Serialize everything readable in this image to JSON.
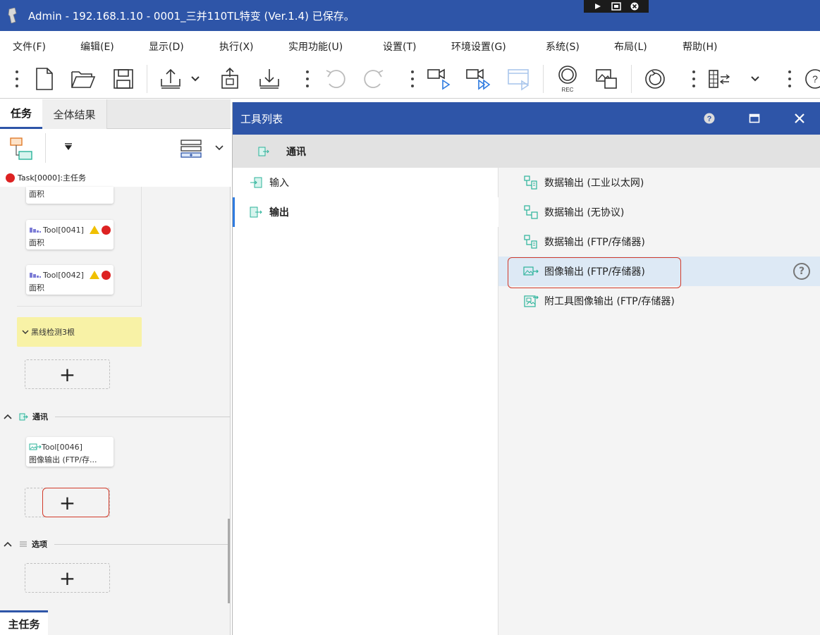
{
  "window": {
    "title": "Admin - 192.168.1.10 - 0001_三并110TL特变 (Ver.1.4) 已保存。"
  },
  "menu": {
    "file": "文件(F)",
    "edit": "编辑(E)",
    "view": "显示(D)",
    "run": "执行(X)",
    "utility": "实用功能(U)",
    "settings": "设置(T)",
    "env": "环境设置(G)",
    "system": "系统(S)",
    "layout": "布局(L)",
    "help": "帮助(H)"
  },
  "toolbar": {
    "rec_label": "REC"
  },
  "left": {
    "tabs": [
      "任务",
      "全体结果"
    ],
    "task_label": "Task[0000]:主任务",
    "partial_card_label": "面积",
    "cards": [
      {
        "id": "Tool[0041]",
        "label": "面积"
      },
      {
        "id": "Tool[0042]",
        "label": "面积"
      }
    ],
    "yellow_group_label": "黑线检测3根",
    "sections": {
      "comm": "通讯",
      "options": "选项"
    },
    "comm_card": {
      "id": "Tool[0046]",
      "label": "图像输出 (FTP/存..."
    },
    "add_symbol": "+",
    "bottom_tab": "主任务"
  },
  "dialog": {
    "title": "工具列表",
    "category": "通讯",
    "left_items": [
      {
        "label": "输入",
        "selected": false
      },
      {
        "label": "输出",
        "selected": true
      }
    ],
    "tools": [
      {
        "label": "数据输出 (工业以太网)",
        "icon": "data-output-icon"
      },
      {
        "label": "数据输出 (无协议)",
        "icon": "data-output-icon"
      },
      {
        "label": "数据输出 (FTP/存储器)",
        "icon": "data-output-icon"
      },
      {
        "label": "图像输出 (FTP/存储器)",
        "icon": "image-output-icon",
        "hover": true
      },
      {
        "label": "附工具图像输出 (FTP/存储器)",
        "icon": "tool-image-output-icon"
      }
    ],
    "help_symbol": "?"
  },
  "colors": {
    "accent": "#2e55a8",
    "highlight": "#d23a2a",
    "hover_row": "#dde9f5",
    "group_yellow": "#f8f2a6",
    "icon_teal": "#2bb39a"
  }
}
